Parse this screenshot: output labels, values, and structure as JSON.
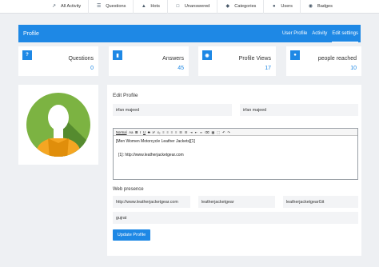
{
  "topnav": {
    "items": [
      {
        "label": "All Activity",
        "icon": "chart-line-icon"
      },
      {
        "label": "Questions",
        "icon": "list-icon"
      },
      {
        "label": "Hots",
        "icon": "flame-icon"
      },
      {
        "label": "Unanswered",
        "icon": "doc-icon"
      },
      {
        "label": "Categories",
        "icon": "tags-icon"
      },
      {
        "label": "Users",
        "icon": "users-icon"
      },
      {
        "label": "Badges",
        "icon": "badge-icon"
      }
    ]
  },
  "profile_bar": {
    "title": "Profile",
    "tabs": [
      "User Profile",
      "Activity",
      "Edit settings"
    ],
    "active_tab": "Edit settings"
  },
  "stats": [
    {
      "label": "Questions",
      "value": "0",
      "icon": "question-icon"
    },
    {
      "label": "Answers",
      "value": "45",
      "icon": "comment-icon"
    },
    {
      "label": "Profile Views",
      "value": "17",
      "icon": "eye-icon"
    },
    {
      "label": "people reached",
      "value": "10",
      "icon": "users-icon"
    }
  ],
  "edit": {
    "heading": "Edit Profile",
    "first_name": "irfan majeed",
    "last_name": "irfan majeed",
    "editor_toolbar": [
      "Normal",
      "Aa",
      "B",
      "I",
      "U",
      "S",
      "x²",
      "x₂",
      "≡",
      "≡",
      "≡",
      "≡",
      "☰",
      "☰",
      "⇥",
      "⇤",
      "∞",
      "⌫",
      "▦",
      "⬚",
      "↶",
      "↷"
    ],
    "editor_line1": "[Men Women Motorcycle Leather Jackets][1]",
    "editor_line2": "[1]: http://www.leatherjacketgear.com",
    "web_heading": "Web presence",
    "website": "http://www.leatherjacketgear.com",
    "twitter": "leatherjacketgear",
    "github": "leatherjacketgearGit",
    "location": "gujrat",
    "submit_label": "Update Profile"
  },
  "colors": {
    "accent": "#1e88e5",
    "avatar_green": "#7cb342",
    "avatar_orange": "#f5a623"
  }
}
